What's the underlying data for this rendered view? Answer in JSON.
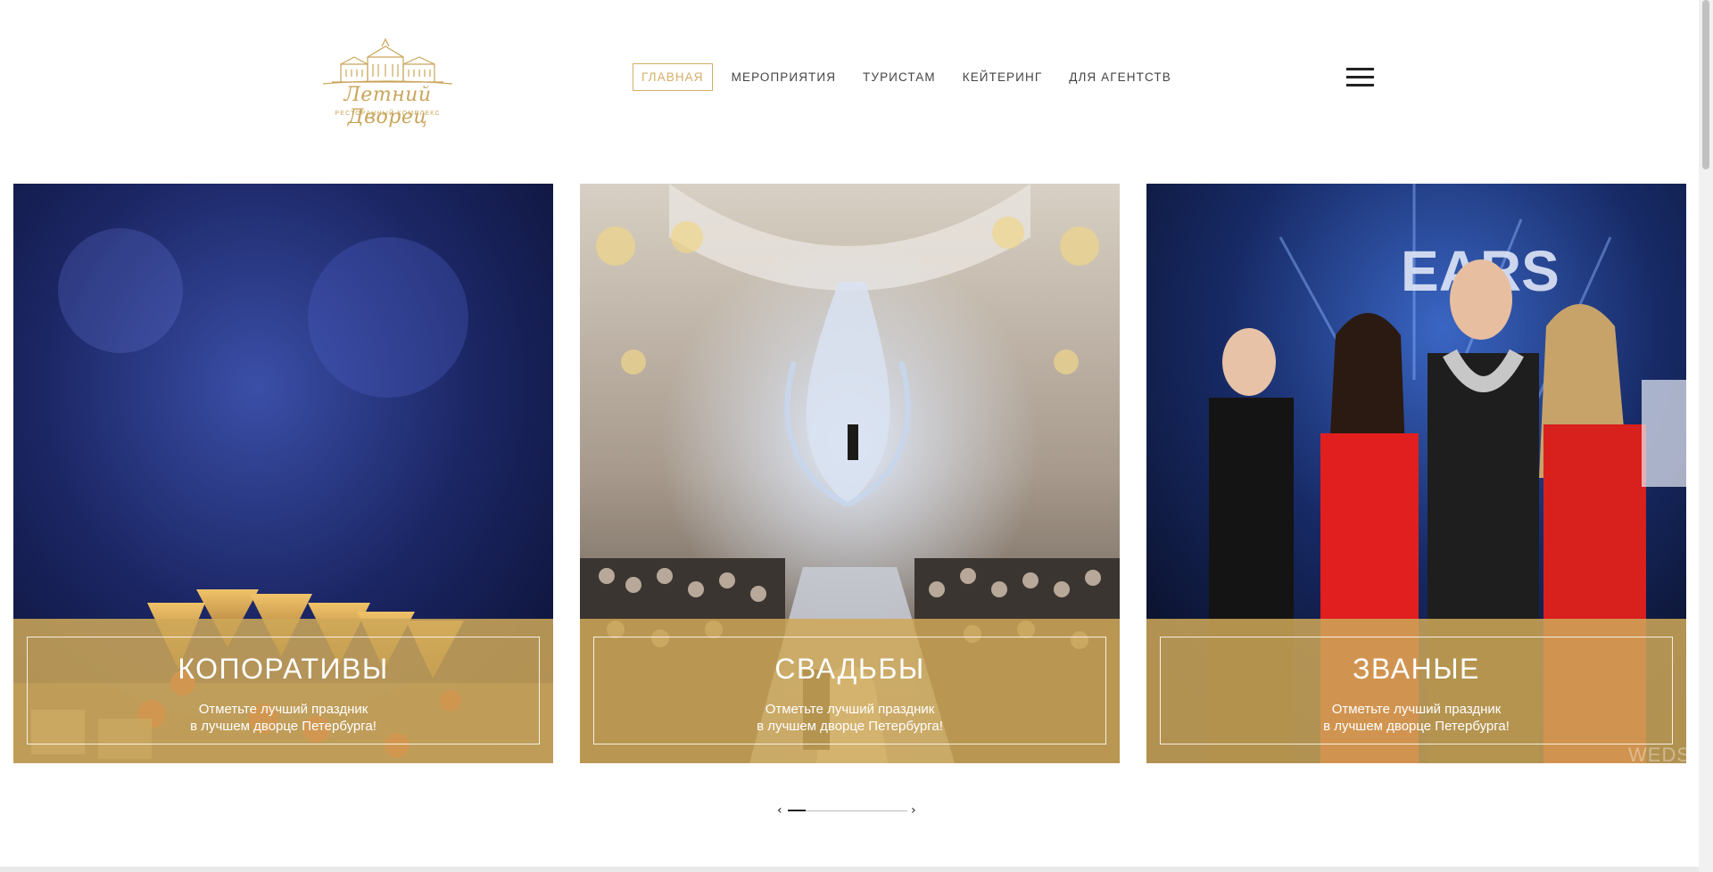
{
  "logo": {
    "title": "Летний Дворец",
    "subtitle": "ресторанный комплекс"
  },
  "nav": {
    "items": [
      {
        "label": "ГЛАВНАЯ",
        "active": true
      },
      {
        "label": "МЕРОПРИЯТИЯ",
        "active": false
      },
      {
        "label": "ТУРИСТАМ",
        "active": false
      },
      {
        "label": "КЕЙТЕРИНГ",
        "active": false
      },
      {
        "label": "ДЛЯ АГЕНТСТВ",
        "active": false
      }
    ],
    "menu_icon": "hamburger-icon"
  },
  "cards": [
    {
      "title": "КОПОРАТИВЫ",
      "text_line1": "Отметьте лучший праздник",
      "text_line2": "в лучшем дворце Петербурга!"
    },
    {
      "title": "СВАДЬБЫ",
      "text_line1": "Отметьте лучший праздник",
      "text_line2": "в лучшем дворце Петербурга!"
    },
    {
      "title": "ЗВАНЫЕ",
      "text_line1": "Отметьте лучший праздник",
      "text_line2": "в лучшем дворце Петербурга!"
    }
  ],
  "card3_watermark": "WEDS",
  "slider": {
    "prev_icon": "‹",
    "next_icon": "›",
    "progress": 0.15
  },
  "colors": {
    "gold": "#d3ae68",
    "overlay": "#cea858"
  }
}
